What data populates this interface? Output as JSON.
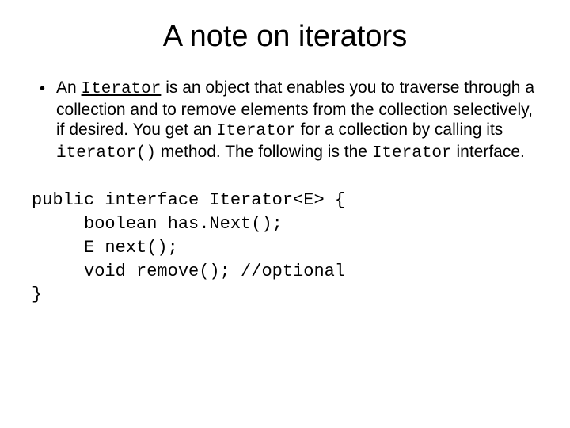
{
  "title": "A note on iterators",
  "bullet": {
    "p1a": "An ",
    "p1_link": "Iterator",
    "p1b": " is an object that enables you to traverse through a collection and to remove elements from the collection selectively, if desired.  You get an ",
    "p1_code2": "Iterator",
    "p1c": " for a collection by calling its ",
    "p1_code3": "iterator()",
    "p1d": " method. The following is the ",
    "p1_code4": "Iterator",
    "p1e": " interface."
  },
  "code": {
    "l1": "public interface Iterator<E> {",
    "l2": "     boolean has.Next();",
    "l3": "     E next();",
    "l4": "     void remove(); //optional",
    "l5": "}"
  }
}
